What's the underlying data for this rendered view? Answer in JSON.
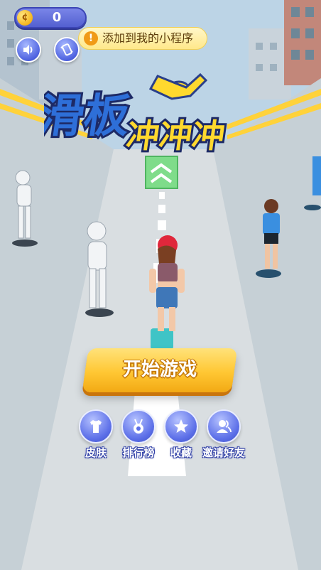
{
  "hud": {
    "coin_icon": "coin-icon",
    "coin_count": "0",
    "sound_icon": "speaker-icon",
    "vibrate_icon": "phone-vibrate-icon"
  },
  "tip": {
    "icon_text": "!",
    "label": "添加到我的小程序"
  },
  "title": {
    "line1": "滑板",
    "line2": "冲冲冲"
  },
  "start_button": {
    "label": "开始游戏"
  },
  "menu": [
    {
      "label": "皮肤",
      "icon": "tshirt-icon"
    },
    {
      "label": "排行榜",
      "icon": "medal-icon"
    },
    {
      "label": "收藏",
      "icon": "star-icon"
    },
    {
      "label": "邀请好友",
      "icon": "friends-icon"
    }
  ],
  "colors": {
    "accent_blue": "#5360d0",
    "button_yellow": "#ffc733",
    "title_blue": "#2e4ea8",
    "title_yellow": "#ffd92e"
  }
}
